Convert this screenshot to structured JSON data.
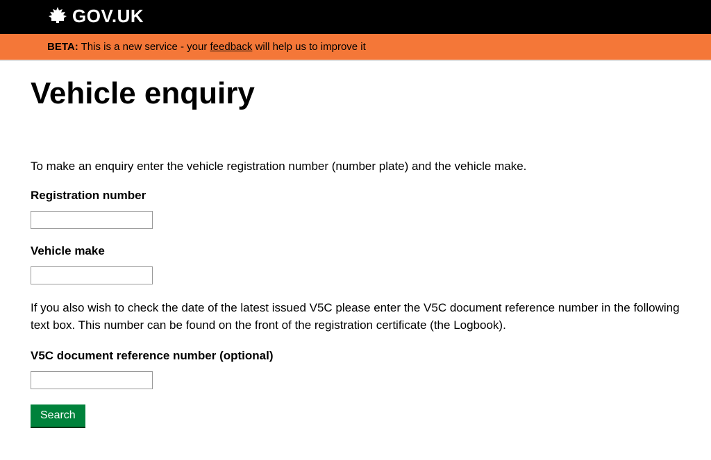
{
  "header": {
    "brand": "GOV.UK"
  },
  "banner": {
    "beta_label": "BETA:",
    "text_before": " This is a new service - your ",
    "feedback_link": "feedback",
    "text_after": " will help us to improve it"
  },
  "page": {
    "title": "Vehicle enquiry",
    "intro": "To make an enquiry enter the vehicle registration number (number plate) and the vehicle make.",
    "reg_label": "Registration number",
    "make_label": "Vehicle make",
    "v5c_help": "If you also wish to check the date of the latest issued V5C please enter the V5C document reference number in the following text box. This number can be found on the front of the registration certificate (the Logbook).",
    "v5c_label": "V5C document reference number (optional)",
    "search_button": "Search"
  }
}
